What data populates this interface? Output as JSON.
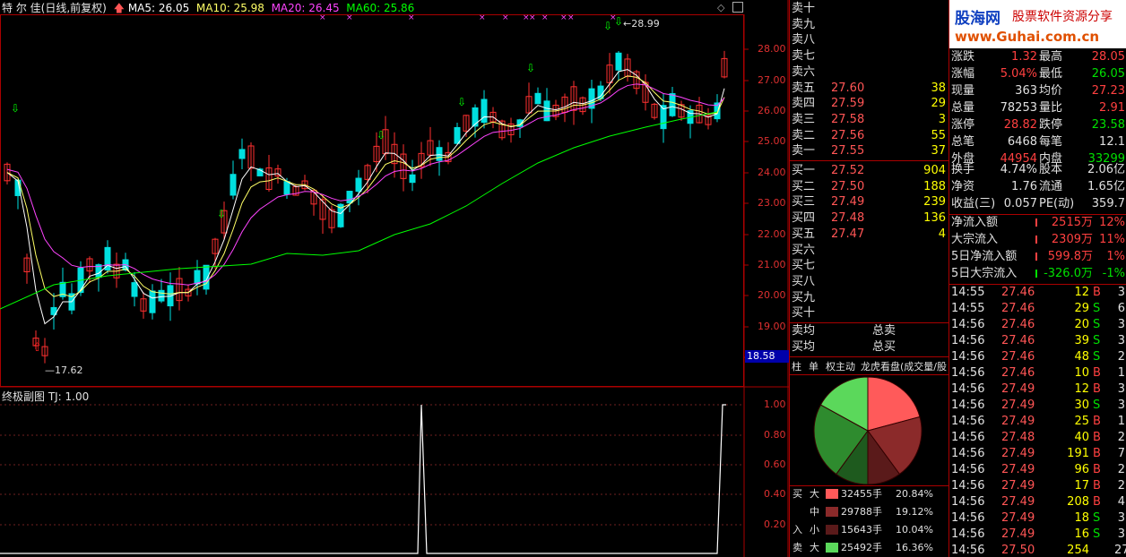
{
  "header": {
    "stock_name": "特 尔 佳",
    "period": "(日线,前复权)",
    "ma5": "MA5: 26.05",
    "ma10": "MA10: 25.98",
    "ma20": "MA20: 26.45",
    "ma60": "MA60: 25.86",
    "colors": {
      "ma5": "#ffffff",
      "ma10": "#ffff66",
      "ma20": "#ff44ff",
      "ma60": "#00ff00"
    }
  },
  "price_axis": {
    "labels": [
      "28.00",
      "27.00",
      "26.00",
      "25.00",
      "24.00",
      "23.00",
      "22.00",
      "21.00",
      "20.00",
      "19.00",
      "18.00"
    ],
    "cursor_label": "18.58"
  },
  "annotations": {
    "high": "28.99",
    "low": "17.62"
  },
  "sub_chart": {
    "title": "终极副图  TJ: 1.00",
    "labels": [
      "1.00",
      "0.80",
      "0.60",
      "0.40",
      "0.20"
    ]
  },
  "logo": {
    "brand": "股海网",
    "slogan": "股票软件资源分享",
    "url": "www.Guhai.com.cn"
  },
  "order_book": {
    "sell": [
      {
        "label": "卖十",
        "price": "",
        "vol": ""
      },
      {
        "label": "卖九",
        "price": "",
        "vol": ""
      },
      {
        "label": "卖八",
        "price": "",
        "vol": ""
      },
      {
        "label": "卖七",
        "price": "",
        "vol": ""
      },
      {
        "label": "卖六",
        "price": "",
        "vol": ""
      },
      {
        "label": "卖五",
        "price": "27.60",
        "vol": "38"
      },
      {
        "label": "卖四",
        "price": "27.59",
        "vol": "29"
      },
      {
        "label": "卖三",
        "price": "27.58",
        "vol": "3"
      },
      {
        "label": "卖二",
        "price": "27.56",
        "vol": "55"
      },
      {
        "label": "卖一",
        "price": "27.55",
        "vol": "37"
      }
    ],
    "buy": [
      {
        "label": "买一",
        "price": "27.52",
        "vol": "904"
      },
      {
        "label": "买二",
        "price": "27.50",
        "vol": "188"
      },
      {
        "label": "买三",
        "price": "27.49",
        "vol": "239"
      },
      {
        "label": "买四",
        "price": "27.48",
        "vol": "136"
      },
      {
        "label": "买五",
        "price": "27.47",
        "vol": "4"
      },
      {
        "label": "买六",
        "price": "",
        "vol": ""
      },
      {
        "label": "买七",
        "price": "",
        "vol": ""
      },
      {
        "label": "买八",
        "price": "",
        "vol": ""
      },
      {
        "label": "买九",
        "price": "",
        "vol": ""
      },
      {
        "label": "买十",
        "price": "",
        "vol": ""
      }
    ],
    "avg_sell_label": "卖均",
    "total_sell_label": "总卖",
    "avg_buy_label": "买均",
    "total_buy_label": "总买"
  },
  "tabs": [
    "柱",
    "单",
    "权主动",
    "龙虎看盘(成交量/股"
  ],
  "pie": {
    "slices": [
      {
        "value": 20.84,
        "color": "#ff5a5a"
      },
      {
        "value": 19.12,
        "color": "#8b2a2a"
      },
      {
        "value": 10.04,
        "color": "#5a1a1a"
      },
      {
        "value": 10.0,
        "color": "#1e5a1e"
      },
      {
        "value": 23.0,
        "color": "#2e8b2e"
      },
      {
        "value": 17.0,
        "color": "#5bd85b"
      }
    ]
  },
  "flow_table": [
    {
      "side": "买",
      "size": "大",
      "vol": "32455手",
      "pct": "20.84%",
      "color": "#ff5a5a"
    },
    {
      "side": "",
      "size": "中",
      "vol": "29788手",
      "pct": "19.12%",
      "color": "#8b2a2a"
    },
    {
      "side": "入",
      "size": "小",
      "vol": "15643手",
      "pct": "10.04%",
      "color": "#5a1a1a"
    },
    {
      "side": "卖",
      "size": "大",
      "vol": "25492手",
      "pct": "16.36%",
      "color": "#5bd85b"
    }
  ],
  "quote": [
    {
      "l1": "涨跌",
      "v1": "1.32",
      "c1": "red",
      "l2": "最高",
      "v2": "28.05",
      "c2": "red"
    },
    {
      "l1": "涨幅",
      "v1": "5.04%",
      "c1": "red",
      "l2": "最低",
      "v2": "26.05",
      "c2": "grn"
    },
    {
      "l1": "现量",
      "v1": "363",
      "c1": "wht",
      "l2": "均价",
      "v2": "27.23",
      "c2": "red"
    },
    {
      "l1": "总量",
      "v1": "78253",
      "c1": "wht",
      "l2": "量比",
      "v2": "2.91",
      "c2": "red"
    },
    {
      "l1": "涨停",
      "v1": "28.82",
      "c1": "red",
      "l2": "跌停",
      "v2": "23.58",
      "c2": "grn"
    },
    {
      "l1": "总笔",
      "v1": "6468",
      "c1": "wht",
      "l2": "每笔",
      "v2": "12.1",
      "c2": "wht"
    },
    {
      "l1": "外盘",
      "v1": "44954",
      "c1": "red",
      "l2": "内盘",
      "v2": "33299",
      "c2": "grn"
    },
    {
      "l1": "换手",
      "v1": "4.74%",
      "c1": "wht",
      "l2": "股本",
      "v2": "2.06亿",
      "c2": "wht"
    },
    {
      "l1": "净资",
      "v1": "1.76",
      "c1": "wht",
      "l2": "流通",
      "v2": "1.65亿",
      "c2": "wht"
    },
    {
      "l1": "收益(三)",
      "v1": "0.057",
      "c1": "wht",
      "l2": "PE(动)",
      "v2": "359.7",
      "c2": "wht"
    }
  ],
  "fund_flow": [
    {
      "label": "净流入额",
      "value": "2515万",
      "pct": "12%",
      "color": "red"
    },
    {
      "label": "大宗流入",
      "value": "2309万",
      "pct": "11%",
      "color": "red"
    },
    {
      "label": "5日净流入额",
      "value": "599.8万",
      "pct": "1%",
      "color": "red"
    },
    {
      "label": "5日大宗流入",
      "value": "-326.0万",
      "pct": "-1%",
      "color": "grn"
    }
  ],
  "ticks": [
    {
      "time": "14:55",
      "price": "27.46",
      "vol": "12",
      "bs": "B",
      "n": "3"
    },
    {
      "time": "14:55",
      "price": "27.46",
      "vol": "29",
      "bs": "S",
      "n": "6"
    },
    {
      "time": "14:56",
      "price": "27.46",
      "vol": "20",
      "bs": "S",
      "n": "3"
    },
    {
      "time": "14:56",
      "price": "27.46",
      "vol": "39",
      "bs": "S",
      "n": "3"
    },
    {
      "time": "14:56",
      "price": "27.46",
      "vol": "48",
      "bs": "S",
      "n": "2"
    },
    {
      "time": "14:56",
      "price": "27.46",
      "vol": "10",
      "bs": "B",
      "n": "1"
    },
    {
      "time": "14:56",
      "price": "27.49",
      "vol": "12",
      "bs": "B",
      "n": "3"
    },
    {
      "time": "14:56",
      "price": "27.49",
      "vol": "30",
      "bs": "S",
      "n": "3"
    },
    {
      "time": "14:56",
      "price": "27.49",
      "vol": "25",
      "bs": "B",
      "n": "1"
    },
    {
      "time": "14:56",
      "price": "27.48",
      "vol": "40",
      "bs": "B",
      "n": "2"
    },
    {
      "time": "14:56",
      "price": "27.49",
      "vol": "191",
      "bs": "B",
      "n": "7"
    },
    {
      "time": "14:56",
      "price": "27.49",
      "vol": "96",
      "bs": "B",
      "n": "2"
    },
    {
      "time": "14:56",
      "price": "27.49",
      "vol": "17",
      "bs": "B",
      "n": "2"
    },
    {
      "time": "14:56",
      "price": "27.49",
      "vol": "208",
      "bs": "B",
      "n": "4"
    },
    {
      "time": "14:56",
      "price": "27.49",
      "vol": "18",
      "bs": "S",
      "n": "3"
    },
    {
      "time": "14:56",
      "price": "27.49",
      "vol": "16",
      "bs": "S",
      "n": "3"
    },
    {
      "time": "14:56",
      "price": "27.50",
      "vol": "254",
      "bs": "",
      "n": "27"
    }
  ]
}
